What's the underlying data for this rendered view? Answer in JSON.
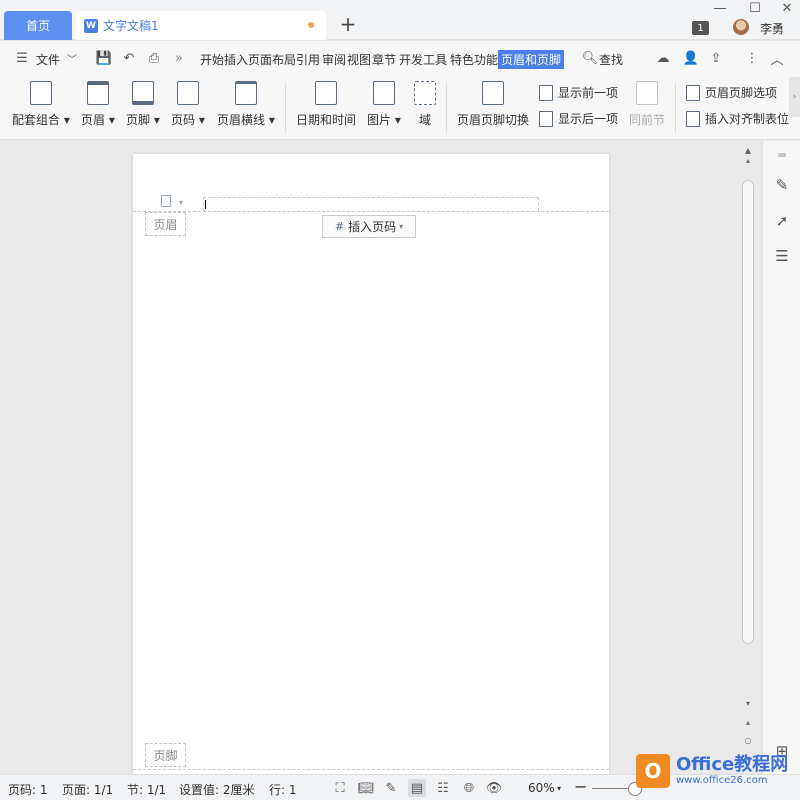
{
  "titlebar": {
    "home_tab": "首页",
    "doc_tab": "文字文稿1",
    "doc_icon": "W",
    "new_tab": "+",
    "badge": "1",
    "user": "李勇",
    "controls": [
      "—",
      "☐",
      "✕"
    ]
  },
  "menubar": {
    "file": "文件",
    "tabs": [
      "开始",
      "插入",
      "页面布局",
      "引用",
      "审阅",
      "视图",
      "章节",
      "开发工具",
      "特色功能",
      "页眉和页脚"
    ],
    "active_tab": "页眉和页脚",
    "search": "查找"
  },
  "ribbon": {
    "group1": [
      {
        "label": "配套组合",
        "caret": true
      },
      {
        "label": "页眉",
        "caret": true
      },
      {
        "label": "页脚",
        "caret": true
      },
      {
        "label": "页码",
        "caret": true
      },
      {
        "label": "页眉横线",
        "caret": true
      }
    ],
    "group2": [
      {
        "label": "日期和时间"
      },
      {
        "label": "图片",
        "caret": true
      },
      {
        "label": "域"
      }
    ],
    "switch": "页眉页脚切换",
    "show_prev": "显示前一项",
    "show_next": "显示后一项",
    "same_as_prev": "同前节",
    "options": "页眉页脚选项",
    "insert_tab": "插入对齐制表位"
  },
  "document": {
    "header_label": "页眉",
    "footer_label": "页脚",
    "insert_page_number": "插入页码"
  },
  "statusbar": {
    "page_num": "页码: 1",
    "pages": "页面: 1/1",
    "section": "节: 1/1",
    "setting": "设置值: 2厘米",
    "row": "行: 1",
    "zoom": "60%"
  },
  "watermark": {
    "logo": "O",
    "line1": "Office教程网",
    "line2": "www.office26.com"
  },
  "colors": {
    "accent": "#4a7fe8",
    "home_tab": "#5b8ff0",
    "modified_dot": "#f2a24f"
  }
}
